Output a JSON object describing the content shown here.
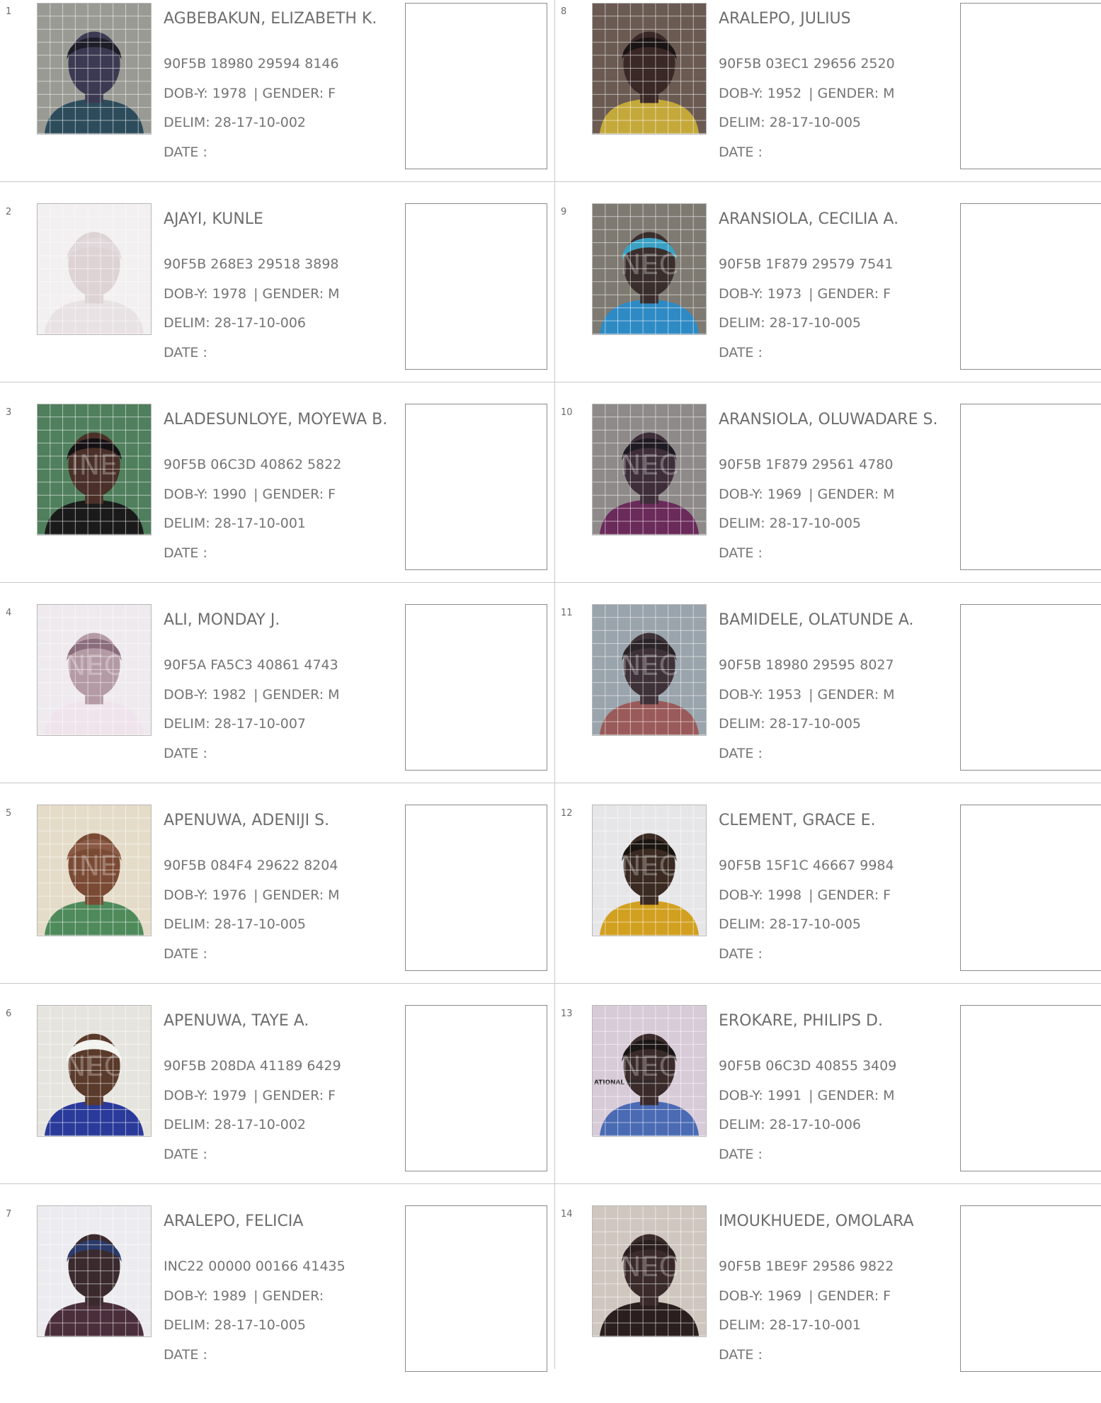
{
  "records": [
    {
      "num": "1",
      "name": "AGBEBAKUN, ELIZABETH K.",
      "vin": "90F5B 18980 29594 8146",
      "dob": "DOB-Y: 1978",
      "gender": "GENDER: F",
      "delim": "DELIM: 28-17-10-002",
      "date": "DATE  :",
      "photo": {
        "bg": "#9a9a94",
        "skin": "#3c3a52",
        "shirt": "#2c4c5c",
        "hair": "#1d1d28",
        "mark": ""
      }
    },
    {
      "num": "2",
      "name": "AJAYI, KUNLE",
      "vin": "90F5B 268E3 29518 3898",
      "dob": "DOB-Y: 1978",
      "gender": "GENDER: M",
      "delim": "DELIM: 28-17-10-006",
      "date": "DATE  :",
      "photo": {
        "bg": "#f2f0f0",
        "skin": "#ddd2d4",
        "shirt": "#e8e2e4",
        "hair": "#e0d8da",
        "mark": ""
      }
    },
    {
      "num": "3",
      "name": "ALADESUNLOYE, MOYEWA B.",
      "vin": "90F5B 06C3D 40862 5822",
      "dob": "DOB-Y: 1990",
      "gender": "GENDER: F",
      "delim": "DELIM: 28-17-10-001",
      "date": "DATE  :",
      "photo": {
        "bg": "#4f7f5c",
        "skin": "#4a3028",
        "shirt": "#1a1a1a",
        "hair": "#141014",
        "mark": "INE"
      }
    },
    {
      "num": "4",
      "name": "ALI, MONDAY J.",
      "vin": "90F5A FA5C3 40861 4743",
      "dob": "DOB-Y: 1982",
      "gender": "GENDER: M",
      "delim": "DELIM: 28-17-10-007",
      "date": "DATE  :",
      "photo": {
        "bg": "#eeeaee",
        "skin": "#b49aa4",
        "shirt": "#f0e4ec",
        "hair": "#8a6c7c",
        "mark": "NEC"
      }
    },
    {
      "num": "5",
      "name": "APENUWA, ADENIJI S.",
      "vin": "90F5B 084F4 29622 8204",
      "dob": "DOB-Y: 1976",
      "gender": "GENDER: M",
      "delim": "DELIM: 28-17-10-005",
      "date": "DATE  :",
      "photo": {
        "bg": "#e4dcc8",
        "skin": "#7a4a34",
        "shirt": "#4e8a5a",
        "hair": "#8a5a44",
        "mark": "INE"
      }
    },
    {
      "num": "6",
      "name": "APENUWA, TAYE A.",
      "vin": "90F5B 208DA 41189 6429",
      "dob": "DOB-Y: 1979",
      "gender": "GENDER: F",
      "delim": "DELIM: 28-17-10-002",
      "date": "DATE  :",
      "photo": {
        "bg": "#e6e4de",
        "skin": "#5a3a2a",
        "shirt": "#2a3a9a",
        "hair": "#f2f2ee",
        "mark": "NEC"
      }
    },
    {
      "num": "7",
      "name": "ARALEPO, FELICIA",
      "vin": "INC22 00000 00166 41435",
      "dob": "DOB-Y: 1989",
      "gender": "GENDER:",
      "delim": "DELIM: 28-17-10-005",
      "date": "DATE  :",
      "photo": {
        "bg": "#ecebef",
        "skin": "#3a2a2e",
        "shirt": "#4a2e3a",
        "hair": "#2a3a6a",
        "mark": ""
      }
    },
    {
      "num": "8",
      "name": "ARALEPO, JULIUS",
      "vin": "90F5B 03EC1 29656 2520",
      "dob": "DOB-Y: 1952",
      "gender": "GENDER: M",
      "delim": "DELIM: 28-17-10-005",
      "date": "DATE  :",
      "photo": {
        "bg": "#6a5a52",
        "skin": "#3a2826",
        "shirt": "#c4a83a",
        "hair": "#1a1414",
        "mark": ""
      }
    },
    {
      "num": "9",
      "name": "ARANSIOLA, CECILIA A.",
      "vin": "90F5B 1F879 29579 7541",
      "dob": "DOB-Y: 1973",
      "gender": "GENDER: F",
      "delim": "DELIM: 28-17-10-005",
      "date": "DATE  :",
      "photo": {
        "bg": "#7e7a72",
        "skin": "#3a2e2c",
        "shirt": "#2e8ac4",
        "hair": "#3aa0c4",
        "mark": "NEC"
      }
    },
    {
      "num": "10",
      "name": "ARANSIOLA, OLUWADARE S.",
      "vin": "90F5B 1F879 29561 4780",
      "dob": "DOB-Y: 1969",
      "gender": "GENDER: M",
      "delim": "DELIM: 28-17-10-005",
      "date": "DATE  :",
      "photo": {
        "bg": "#8e8a8a",
        "skin": "#3e2e3a",
        "shirt": "#6a2a5a",
        "hair": "#1e1a22",
        "mark": "NEC"
      }
    },
    {
      "num": "11",
      "name": "BAMIDELE, OLATUNDE A.",
      "vin": "90F5B 18980 29595 8027",
      "dob": "DOB-Y: 1953",
      "gender": "GENDER: M",
      "delim": "DELIM: 28-17-10-005",
      "date": "DATE  :",
      "photo": {
        "bg": "#9aa4ac",
        "skin": "#3e3238",
        "shirt": "#9a5a5a",
        "hair": "#2a2428",
        "mark": "NEC"
      }
    },
    {
      "num": "12",
      "name": "CLEMENT, GRACE E.",
      "vin": "90F5B 15F1C 46667 9984",
      "dob": "DOB-Y: 1998",
      "gender": "GENDER: F",
      "delim": "DELIM: 28-17-10-005",
      "date": "DATE  :",
      "photo": {
        "bg": "#e6e6e8",
        "skin": "#3a2a22",
        "shirt": "#d2a020",
        "hair": "#1a1410",
        "mark": "NEC"
      }
    },
    {
      "num": "13",
      "name": "EROKARE, PHILIPS D.",
      "vin": "90F5B 06C3D 40855 3409",
      "dob": "DOB-Y: 1991",
      "gender": "GENDER: M",
      "delim": "DELIM: 28-17-10-006",
      "date": "DATE  :",
      "photo": {
        "bg": "#d8cbd8",
        "skin": "#3a2a2a",
        "shirt": "#4a6ab4",
        "hair": "#1a1616",
        "mark": "NEC",
        "side_text": "ATIONAL MISSION"
      }
    },
    {
      "num": "14",
      "name": "IMOUKHUEDE, OMOLARA",
      "vin": "90F5B 1BE9F 29586 9822",
      "dob": "DOB-Y: 1969",
      "gender": "GENDER: F",
      "delim": "DELIM: 28-17-10-001",
      "date": "DATE  :",
      "photo": {
        "bg": "#cfc7bf",
        "skin": "#3a2a2a",
        "shirt": "#2a1e1e",
        "hair": "#2a1e1e",
        "mark": "NEC"
      }
    }
  ]
}
